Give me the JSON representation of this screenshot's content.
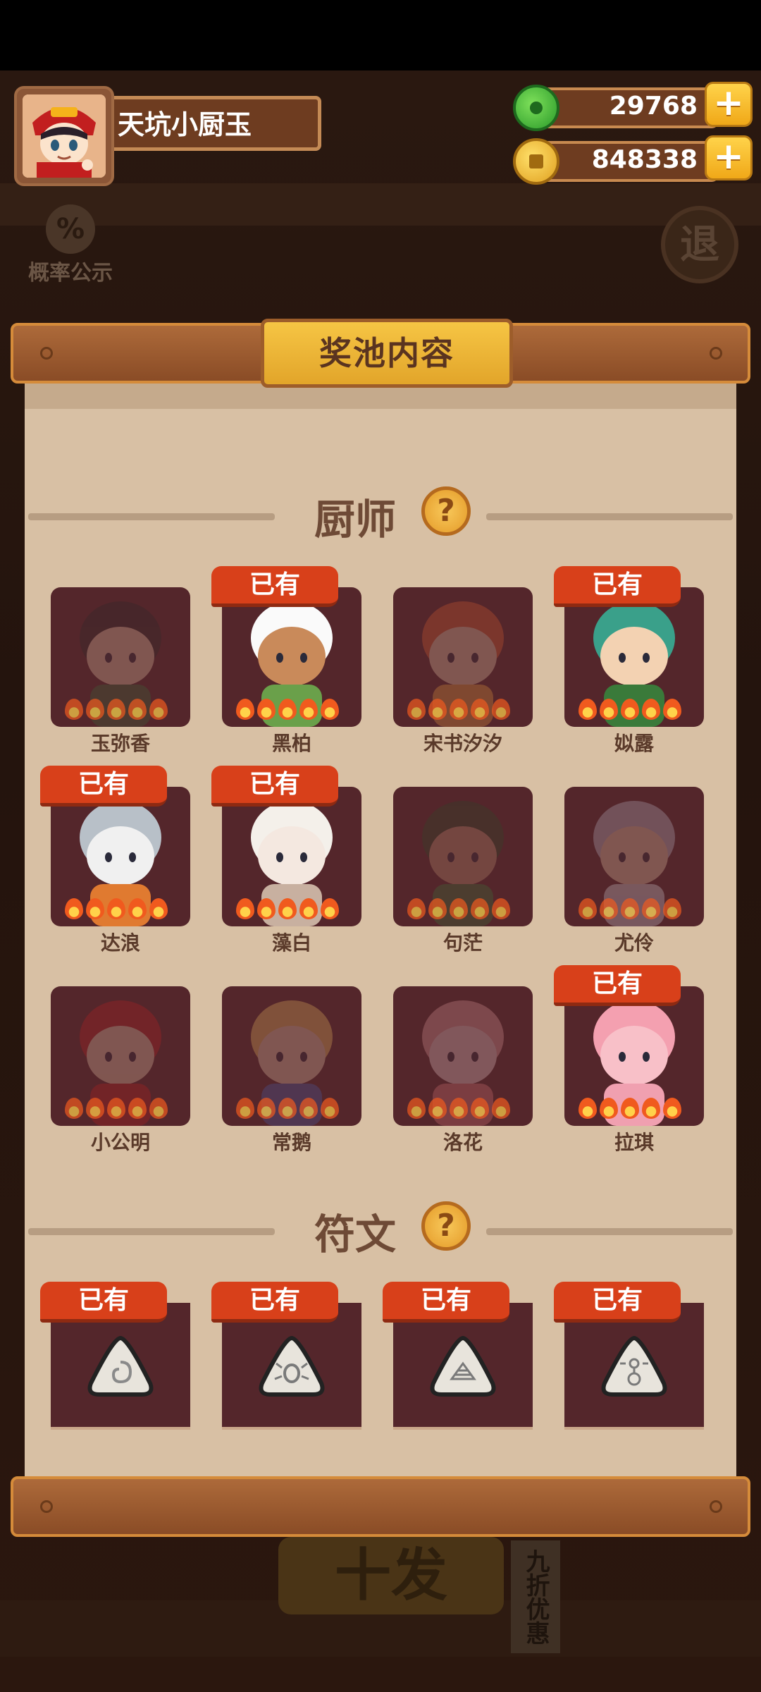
{
  "player": {
    "name": "天坑小厨玉"
  },
  "currency": {
    "jade": "29768",
    "coins": "848338",
    "plus_symbol": "+"
  },
  "background": {
    "probability_label": "概率公示",
    "probability_icon": "%",
    "exit_label": "退",
    "ten_pull_label": "十发",
    "discount_label": "九折优惠"
  },
  "modal": {
    "title": "奖池内容",
    "help_symbol": "?"
  },
  "chefs_section": {
    "title": "厨师",
    "owned_label": "已有",
    "items": [
      {
        "name": "玉弥香",
        "owned": false
      },
      {
        "name": "黑柏",
        "owned": true
      },
      {
        "name": "宋书汐汐",
        "owned": false
      },
      {
        "name": "姒露",
        "owned": true
      },
      {
        "name": "达浪",
        "owned": true
      },
      {
        "name": "藻白",
        "owned": true
      },
      {
        "name": "句茫",
        "owned": false
      },
      {
        "name": "尤伶",
        "owned": false
      },
      {
        "name": "小公明",
        "owned": false
      },
      {
        "name": "常鹅",
        "owned": false
      },
      {
        "name": "洛花",
        "owned": false
      },
      {
        "name": "拉琪",
        "owned": true
      }
    ]
  },
  "runes_section": {
    "title": "符文",
    "owned_label": "已有",
    "items": [
      {
        "icon": "spiral-rune-icon",
        "owned": true
      },
      {
        "icon": "beetle-rune-icon",
        "owned": true
      },
      {
        "icon": "mountain-rune-icon",
        "owned": true
      },
      {
        "icon": "flower-rune-icon",
        "owned": true
      }
    ]
  },
  "colors": {
    "owned_tag": "#d8401a",
    "card_bg": "#54262b",
    "panel_bg": "#d8c0a4",
    "flame": "#f05a1e"
  }
}
